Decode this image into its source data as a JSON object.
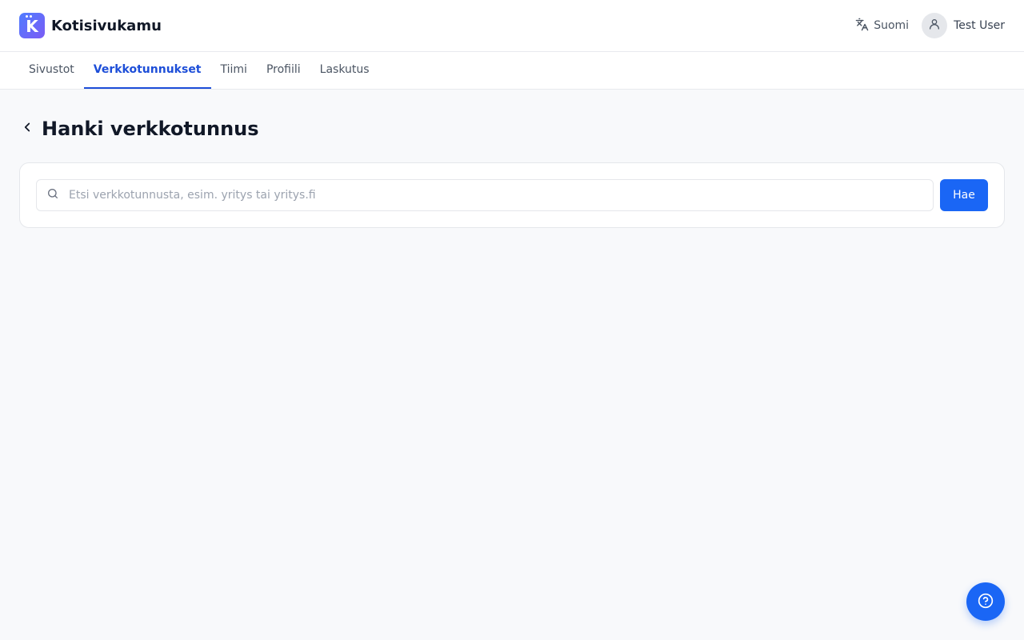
{
  "app": {
    "name": "Kotisivukamu",
    "logo_letter": "K"
  },
  "header": {
    "language_label": "Suomi",
    "language_icon": "translate-icon",
    "user_name": "Test User",
    "user_icon": "user-icon"
  },
  "tabs": [
    {
      "label": "Sivustot",
      "active": false
    },
    {
      "label": "Verkkotunnukset",
      "active": true
    },
    {
      "label": "Tiimi",
      "active": false
    },
    {
      "label": "Profiili",
      "active": false
    },
    {
      "label": "Laskutus",
      "active": false
    }
  ],
  "page": {
    "title": "Hanki verkkotunnus",
    "back_icon": "chevron-left-icon"
  },
  "search": {
    "value": "",
    "placeholder": "Etsi verkkotunnusta, esim. yritys tai yritys.fi",
    "button_label": "Hae",
    "icon": "search-icon"
  },
  "help": {
    "icon": "help-circle-icon"
  },
  "colors": {
    "accent": "#1a66f5",
    "active_tab": "#1d4ed8",
    "background": "#f8f9fb"
  }
}
